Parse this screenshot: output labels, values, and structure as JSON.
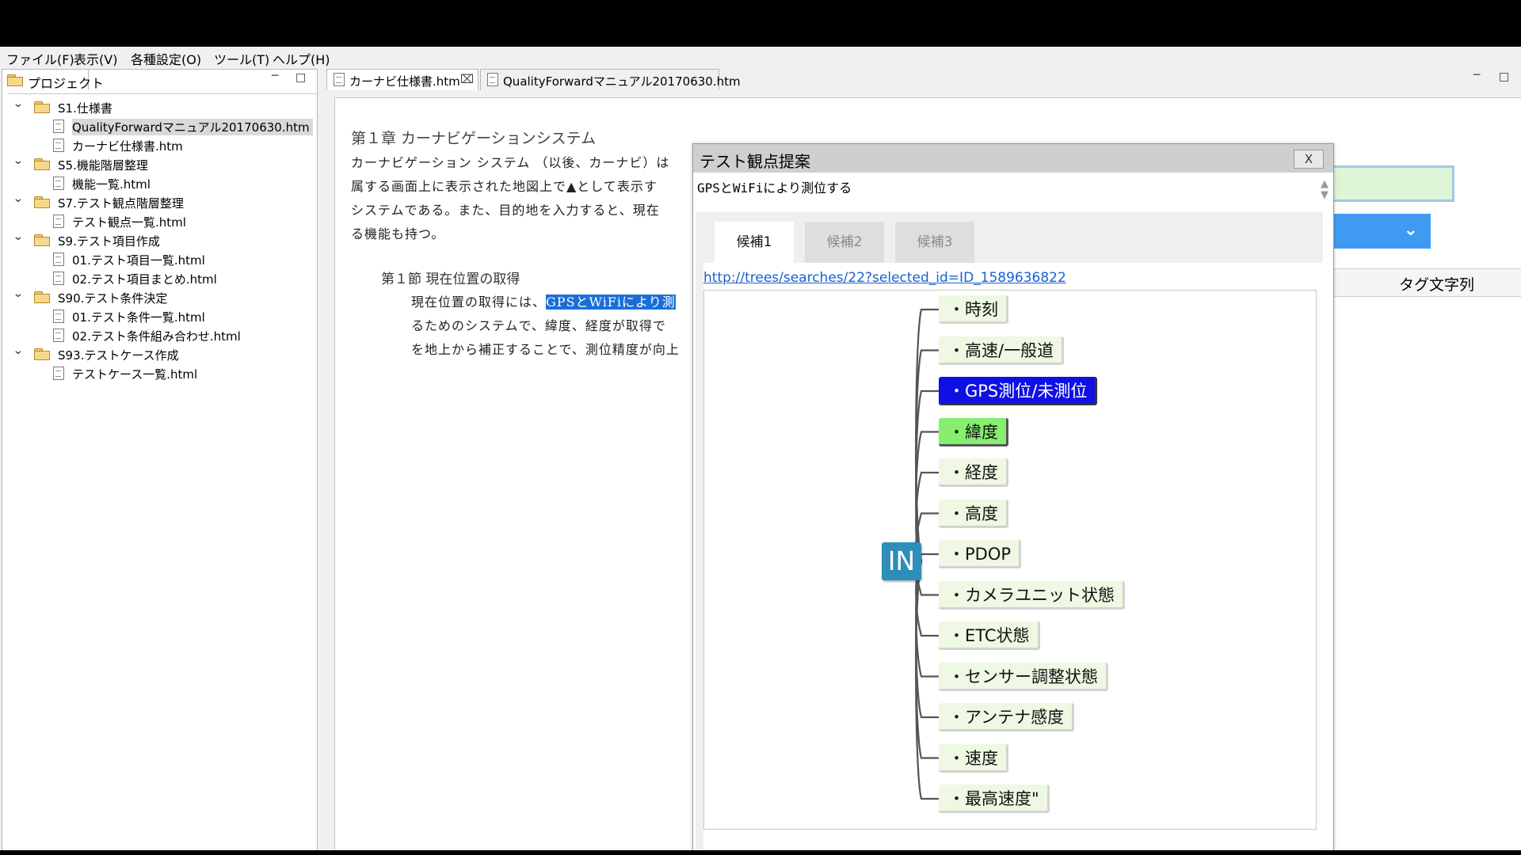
{
  "menu": [
    "ファイル(F)",
    "表示(V)",
    "各種設定(O)",
    "ツール(T)",
    "ヘルプ(H)"
  ],
  "project_panel": {
    "title": "プロジェクト",
    "tree": [
      {
        "kind": "folder",
        "label": "S1.仕様書"
      },
      {
        "kind": "file",
        "label": "QualityForwardマニュアル20170630.htm",
        "selected": true
      },
      {
        "kind": "file",
        "label": "カーナビ仕様書.htm"
      },
      {
        "kind": "folder",
        "label": "S5.機能階層整理"
      },
      {
        "kind": "file",
        "label": "機能一覧.html"
      },
      {
        "kind": "folder",
        "label": "S7.テスト観点階層整理"
      },
      {
        "kind": "file",
        "label": "テスト観点一覧.html"
      },
      {
        "kind": "folder",
        "label": "S9.テスト項目作成"
      },
      {
        "kind": "file",
        "label": "01.テスト項目一覧.html"
      },
      {
        "kind": "file",
        "label": "02.テスト項目まとめ.html"
      },
      {
        "kind": "folder",
        "label": "S90.テスト条件決定"
      },
      {
        "kind": "file",
        "label": "01.テスト条件一覧.html"
      },
      {
        "kind": "file",
        "label": "02.テスト条件組み合わせ.html"
      },
      {
        "kind": "folder",
        "label": "S93.テストケース作成"
      },
      {
        "kind": "file",
        "label": "テストケース一覧.html"
      }
    ]
  },
  "editor": {
    "tabs": [
      "カーナビ仕様書.htm",
      "QualityForwardマニュアル20170630.htm"
    ],
    "chapter": "第１章  カーナビゲーションシステム",
    "para1": [
      "カーナビゲーション システム （以後、カーナビ）は",
      "属する画面上に表示された地図上で▲として表示す",
      "システムである。また、目的地を入力すると、現在",
      "る機能も持つ。"
    ],
    "section": "第１節      現在位置の取得",
    "para2_line1_prefix": "現在位置の取得には、",
    "para2_line1_highlight": "GPSとWiFiにより測",
    "para2_lines": [
      "るためのシステムで、緯度、経度が取得で",
      "を地上から補正することで、測位精度が向上"
    ]
  },
  "right_panel": {
    "tag_header": "タグ文字列"
  },
  "dialog": {
    "title": "テスト観点提案",
    "close_label": "X",
    "input_value": "GPSとWiFiにより測位する",
    "tabs": [
      "候補1",
      "候補2",
      "候補3"
    ],
    "active_tab": 0,
    "link": "http://trees/searches/22?selected_id=ID_1589636822",
    "mindmap": {
      "root": "IN",
      "nodes": [
        {
          "label": "・時刻",
          "state": "normal"
        },
        {
          "label": "・高速/一般道",
          "state": "normal"
        },
        {
          "label": "・GPS測位/未測位",
          "state": "selected"
        },
        {
          "label": "・緯度",
          "state": "hover"
        },
        {
          "label": "・経度",
          "state": "normal"
        },
        {
          "label": "・高度",
          "state": "normal"
        },
        {
          "label": "・PDOP",
          "state": "normal"
        },
        {
          "label": "・カメラユニット状態",
          "state": "normal"
        },
        {
          "label": "・ETC状態",
          "state": "normal"
        },
        {
          "label": "・センサー調整状態",
          "state": "normal"
        },
        {
          "label": "・アンテナ感度",
          "state": "normal"
        },
        {
          "label": "・速度",
          "state": "normal"
        },
        {
          "label": "・最高速度\"",
          "state": "normal"
        }
      ]
    }
  },
  "colors": {
    "selected_node": "#1010e6",
    "hover_node": "#86f06e",
    "root_node": "#2d8fb8",
    "highlight": "#1a6fd6"
  }
}
